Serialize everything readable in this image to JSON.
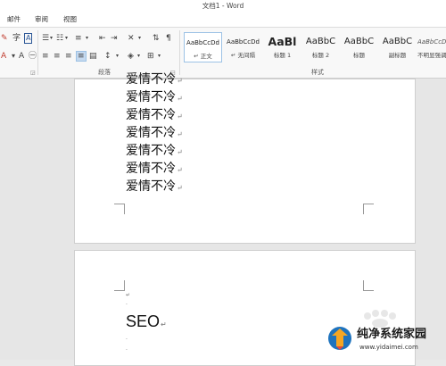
{
  "window": {
    "title": "文档1 - Word"
  },
  "tabs": [
    {
      "label": "邮件"
    },
    {
      "label": "审阅"
    },
    {
      "label": "视图"
    }
  ],
  "ribbon": {
    "groups": {
      "paragraph": {
        "label": "段落"
      },
      "styles": {
        "label": "样式"
      }
    },
    "styles": [
      {
        "sample": "AaBbCcDd",
        "name": "↵ 正文",
        "selected": true
      },
      {
        "sample": "AaBbCcDd",
        "name": "↵ 无间隔",
        "selected": false
      },
      {
        "sample": "AaBl",
        "name": "标题 1",
        "selected": false
      },
      {
        "sample": "AaBbC",
        "name": "标题 2",
        "selected": false
      },
      {
        "sample": "AaBbC",
        "name": "标题",
        "selected": false
      },
      {
        "sample": "AaBbC",
        "name": "副标题",
        "selected": false
      },
      {
        "sample": "AaBbCcD",
        "name": "不明显强调",
        "selected": false
      }
    ],
    "font_icons": {
      "font_color": "A",
      "text_highlight": "A"
    }
  },
  "document": {
    "page1_lines": [
      "爱情不冷",
      "爱情不冷",
      "爱情不冷",
      "爱情不冷",
      "爱情不冷",
      "爱情不冷",
      "爱情不冷"
    ],
    "paragraph_mark": "↵",
    "page2_text": "SEO"
  },
  "watermark": {
    "title": "纯净系统家园",
    "url": "www.yidaimei.com"
  },
  "colors": {
    "accent": "#2b5797",
    "selected_style_border": "#9dc2e5",
    "page_bg": "#ffffff",
    "doc_area_bg": "#e6e6e6"
  }
}
